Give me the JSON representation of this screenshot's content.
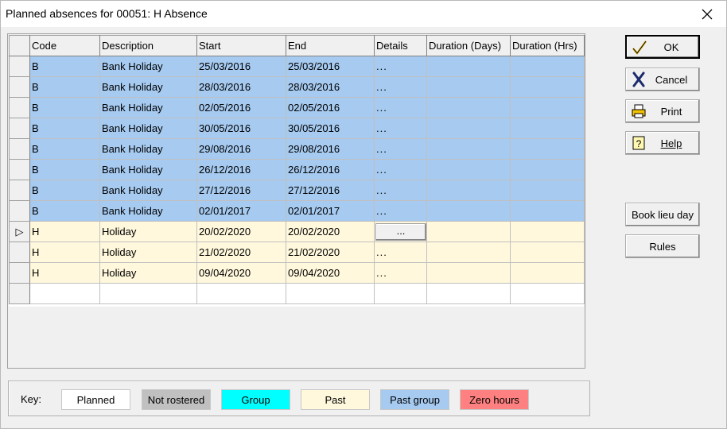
{
  "window": {
    "title": "Planned absences for 00051: H Absence"
  },
  "columns": [
    "Code",
    "Description",
    "Start",
    "End",
    "Details",
    "Duration (Days)",
    "Duration (Hrs)"
  ],
  "rows": [
    {
      "code": "B",
      "description": "Bank Holiday",
      "start": "25/03/2016",
      "end": "25/03/2016",
      "details": "...",
      "days": "",
      "hrs": ""
    },
    {
      "code": "B",
      "description": "Bank Holiday",
      "start": "28/03/2016",
      "end": "28/03/2016",
      "details": "...",
      "days": "",
      "hrs": ""
    },
    {
      "code": "B",
      "description": "Bank Holiday",
      "start": "02/05/2016",
      "end": "02/05/2016",
      "details": "...",
      "days": "",
      "hrs": ""
    },
    {
      "code": "B",
      "description": "Bank Holiday",
      "start": "30/05/2016",
      "end": "30/05/2016",
      "details": "...",
      "days": "",
      "hrs": ""
    },
    {
      "code": "B",
      "description": "Bank Holiday",
      "start": "29/08/2016",
      "end": "29/08/2016",
      "details": "...",
      "days": "",
      "hrs": ""
    },
    {
      "code": "B",
      "description": "Bank Holiday",
      "start": "26/12/2016",
      "end": "26/12/2016",
      "details": "...",
      "days": "",
      "hrs": ""
    },
    {
      "code": "B",
      "description": "Bank Holiday",
      "start": "27/12/2016",
      "end": "27/12/2016",
      "details": "...",
      "days": "",
      "hrs": ""
    },
    {
      "code": "B",
      "description": "Bank Holiday",
      "start": "02/01/2017",
      "end": "02/01/2017",
      "details": "...",
      "days": "",
      "hrs": ""
    },
    {
      "code": "H",
      "description": "Holiday",
      "start": "20/02/2020",
      "end": "20/02/2020",
      "details": "...",
      "days": "",
      "hrs": ""
    },
    {
      "code": "H",
      "description": "Holiday",
      "start": "21/02/2020",
      "end": "21/02/2020",
      "details": "...",
      "days": "",
      "hrs": ""
    },
    {
      "code": "H",
      "description": "Holiday",
      "start": "09/04/2020",
      "end": "09/04/2020",
      "details": "...",
      "days": "",
      "hrs": ""
    }
  ],
  "current_row_marker": "▷",
  "buttons": {
    "ok": "OK",
    "cancel": "Cancel",
    "print": "Print",
    "help": "Help",
    "book_lieu_day": "Book lieu day",
    "rules": "Rules"
  },
  "key": {
    "label": "Key:",
    "items": [
      {
        "label": "Planned",
        "color": "#ffffff"
      },
      {
        "label": "Not rostered",
        "color": "#c0c0c0"
      },
      {
        "label": "Group",
        "color": "#00ffff"
      },
      {
        "label": "Past",
        "color": "#fff8dc"
      },
      {
        "label": "Past group",
        "color": "#a6caf0"
      },
      {
        "label": "Zero hours",
        "color": "#ff8080"
      }
    ]
  },
  "icons": {
    "ok": "checkmark-icon",
    "cancel": "x-cross-icon",
    "print": "printer-icon",
    "help": "help-book-icon",
    "close": "close-icon"
  }
}
